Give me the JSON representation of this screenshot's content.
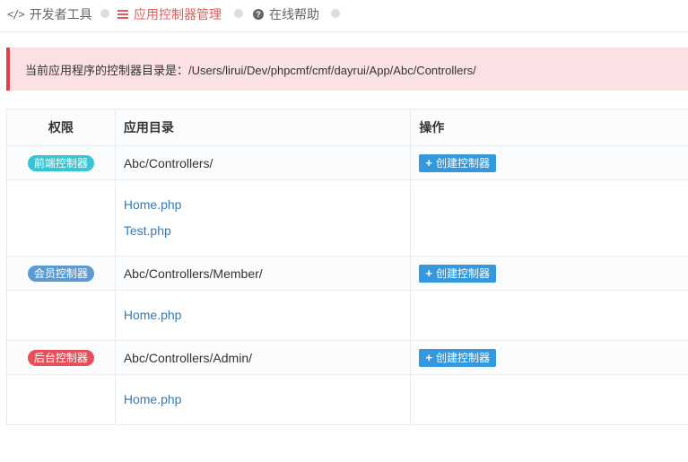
{
  "nav": {
    "items": [
      {
        "label": "开发者工具",
        "icon": "code-icon"
      },
      {
        "label": "应用控制器管理",
        "icon": "list-icon"
      },
      {
        "label": "在线帮助",
        "icon": "help-icon"
      }
    ]
  },
  "alert": {
    "text": "当前应用程序的控制器目录是：/Users/lirui/Dev/phpcmf/cmf/dayrui/App/Abc/Controllers/"
  },
  "table": {
    "headers": [
      "权限",
      "应用目录",
      "操作"
    ],
    "groups": [
      {
        "badge": "前端控制器",
        "badge_color": "#36c6d3",
        "directory": "Abc/Controllers/",
        "action_label": "创建控制器",
        "files": [
          "Home.php",
          "Test.php"
        ]
      },
      {
        "badge": "会员控制器",
        "badge_color": "#5c9bd1",
        "directory": "Abc/Controllers/Member/",
        "action_label": "创建控制器",
        "files": [
          "Home.php"
        ]
      },
      {
        "badge": "后台控制器",
        "badge_color": "#e7505a",
        "directory": "Abc/Controllers/Admin/",
        "action_label": "创建控制器",
        "files": [
          "Home.php"
        ]
      }
    ]
  },
  "colors": {
    "accent_active": "#e35b5a",
    "button": "#3598dc",
    "link": "#337ab7",
    "alert_bg": "#fbe1e3"
  }
}
